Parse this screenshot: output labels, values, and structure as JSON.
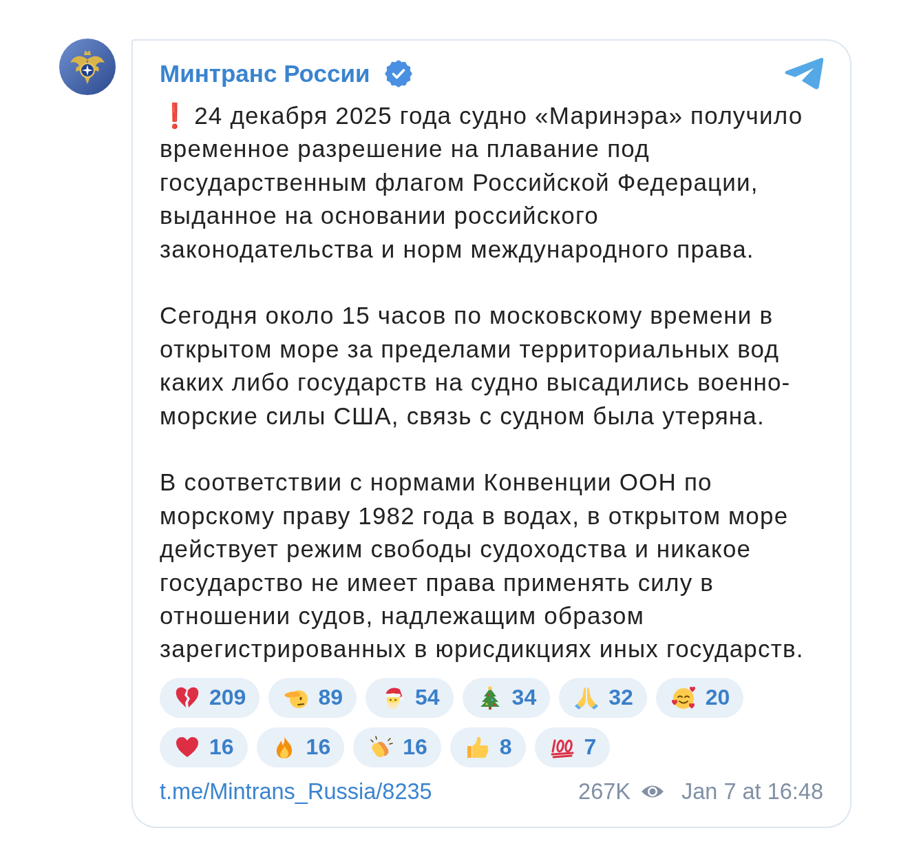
{
  "channel": {
    "name": "Минтранс России",
    "verified": true
  },
  "post": {
    "paragraphs": [
      {
        "kind": "alert",
        "text": "❗ 24 декабря 2025 года судно «Маринэра» получило временное разрешение на плавание под государственным флагом Российской Федерации, выданное на основании российского законодательства и норм международного права."
      },
      {
        "kind": "plain",
        "text": "Сегодня около 15 часов по московскому времени в открытом море за пределами территориальных вод каких либо государств на судно высадились военно-морские силы США, связь с судном была утеряна."
      },
      {
        "kind": "plain",
        "text": "В соответствии с нормами Конвенции ООН по морскому праву 1982 года в водах, в открытом море действует режим свободы судоходства и никакое государство не имеет права применять силу в отношении судов, надлежащим образом зарегистрированных в юрисдикциях иных государств."
      }
    ]
  },
  "reactions": [
    {
      "kind": "heartbreak",
      "count": "209"
    },
    {
      "kind": "salute",
      "count": "89"
    },
    {
      "kind": "santa",
      "count": "54"
    },
    {
      "kind": "tree",
      "count": "34"
    },
    {
      "kind": "pray",
      "count": "32"
    },
    {
      "kind": "hearts",
      "count": "20"
    },
    {
      "kind": "heart",
      "count": "16"
    },
    {
      "kind": "fire",
      "count": "16"
    },
    {
      "kind": "clap",
      "count": "16"
    },
    {
      "kind": "like",
      "count": "8"
    },
    {
      "kind": "hundred",
      "count": "7"
    }
  ],
  "footer": {
    "link": "t.me/Mintrans_Russia/8235",
    "views": "267K",
    "date": "Jan 7 at 16:48"
  }
}
